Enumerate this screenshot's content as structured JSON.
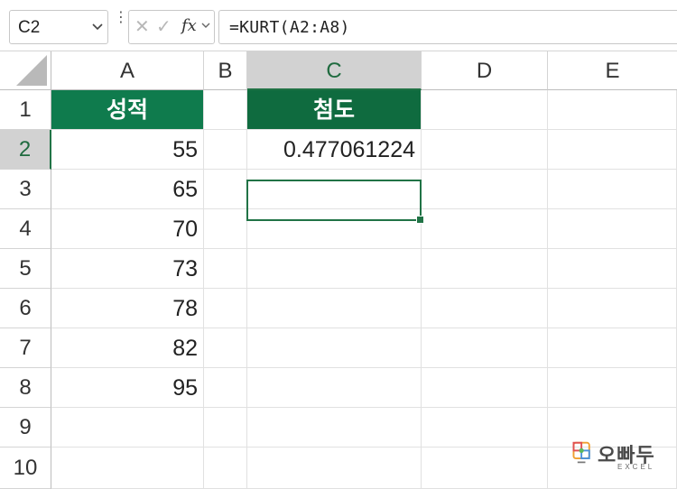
{
  "formula_bar": {
    "name_box": "C2",
    "cancel_glyph": "✕",
    "enter_glyph": "✓",
    "fx_label": "fx",
    "formula": "=KURT(A2:A8)"
  },
  "columns": [
    "A",
    "B",
    "C",
    "D",
    "E"
  ],
  "rows": [
    "1",
    "2",
    "3",
    "4",
    "5",
    "6",
    "7",
    "8",
    "9",
    "10"
  ],
  "selected_cell": "C2",
  "cells": {
    "A1": "성적",
    "C1": "첨도",
    "C2": "0.477061224",
    "A2": "55",
    "A3": "65",
    "A4": "70",
    "A5": "73",
    "A6": "78",
    "A7": "82",
    "A8": "95"
  },
  "logo": {
    "name": "오빠두",
    "sub": "EXCEL"
  },
  "colors": {
    "header_green": "#0f7b4d",
    "header_dark_green": "#0f6b3f",
    "selection": "#217346"
  },
  "icons": {
    "name_box_dropdown": "chevron-down-icon",
    "cancel": "cancel-icon",
    "enter": "enter-icon",
    "insert_function": "fx-icon"
  }
}
